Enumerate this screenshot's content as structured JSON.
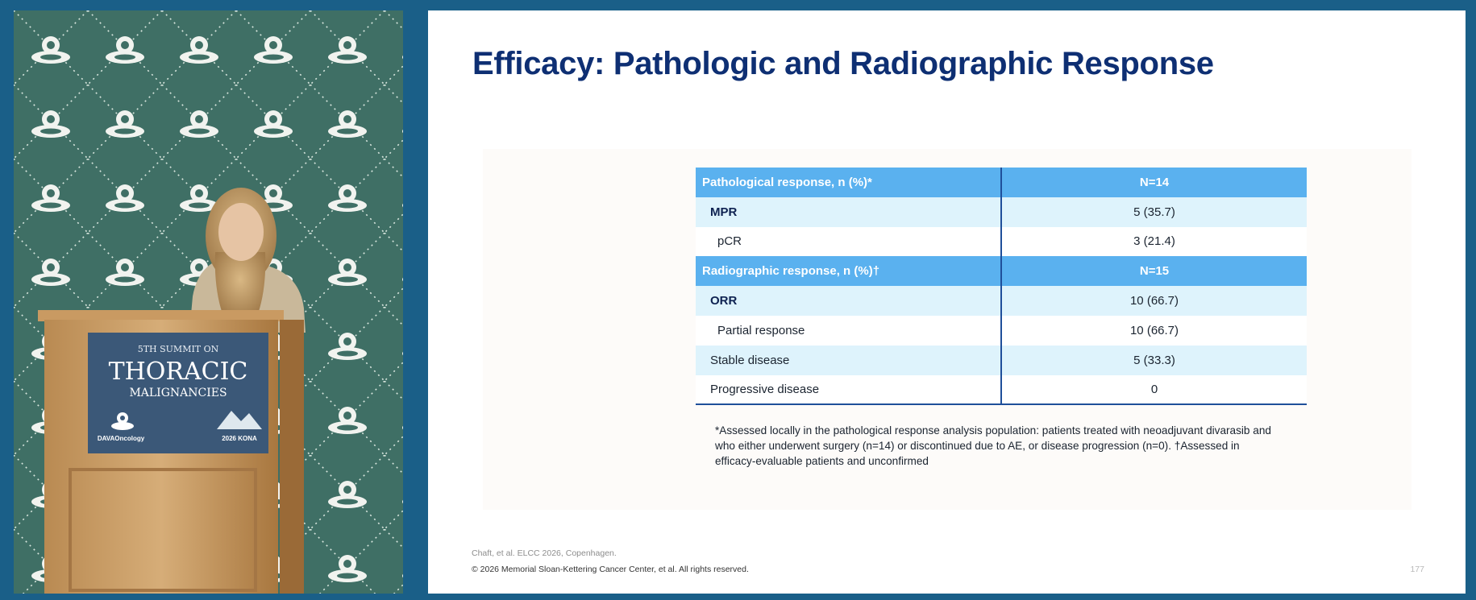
{
  "podium": {
    "line1": "5TH SUMMIT ON",
    "line2": "THORACIC",
    "line3": "MALIGNANCIES",
    "brand": "DAVAOncology",
    "event": "2026 KONA"
  },
  "slide": {
    "title": "Efficacy: Pathologic and Radiographic Response",
    "table": {
      "rows": [
        {
          "label": "Pathological response, n (%)*",
          "value": "N=14"
        },
        {
          "label": "MPR",
          "value": "5 (35.7)"
        },
        {
          "label": "pCR",
          "value": "3 (21.4)"
        },
        {
          "label": "Radiographic response, n (%)†",
          "value": "N=15"
        },
        {
          "label": "ORR",
          "value": "10 (66.7)"
        },
        {
          "label": "Partial response",
          "value": "10 (66.7)"
        },
        {
          "label": "Stable disease",
          "value": "5 (33.3)"
        },
        {
          "label": "Progressive disease",
          "value": "0"
        }
      ]
    },
    "footnote": "*Assessed locally in the pathological response analysis population: patients treated with neoadjuvant divarasib and who either underwent surgery (n=14) or discontinued due to AE, or disease progression (n=0). †Assessed in efficacy-evaluable patients and unconfirmed",
    "citation": "Chaft, et al. ELCC 2026, Copenhagen.",
    "copyright": "© 2026 Memorial Sloan-Kettering Cancer Center, et al. All rights reserved.",
    "page_number": "177"
  },
  "colors": {
    "frame": "#1a5f88",
    "title": "#0e2f73",
    "table_header": "#5ab1ef",
    "table_alt_row": "#def3fc",
    "table_rule": "#1f4f9a",
    "backdrop": "#3f6f65"
  }
}
